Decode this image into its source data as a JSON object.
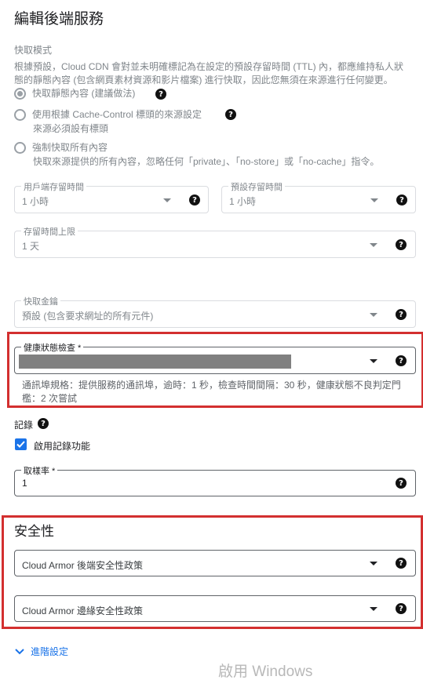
{
  "page": {
    "title": "編輯後端服務"
  },
  "cache_mode": {
    "label": "快取模式",
    "description": "根據預設，Cloud CDN 會對並未明確標記為在設定的預設存留時間 (TTL) 內，都應維持私人狀態的靜態內容 (包含網頁素材資源和影片檔案) 進行快取，因此您無須在來源進行任何變更。",
    "options": [
      {
        "label": "快取靜態內容 (建議做法)",
        "selected": true
      },
      {
        "label": "使用根據 Cache-Control 標頭的來源設定",
        "sub": "來源必須設有標頭",
        "selected": false
      },
      {
        "label": "強制快取所有內容",
        "sub": "快取來源提供的所有內容，忽略任何「private」、「no-store」或「no-cache」指令。",
        "selected": false
      }
    ]
  },
  "client_ttl": {
    "label": "用戶端存留時間",
    "value": "1 小時"
  },
  "default_ttl": {
    "label": "預設存留時間",
    "value": "1 小時"
  },
  "max_ttl": {
    "label": "存留時間上限",
    "value": "1 天"
  },
  "cache_key": {
    "label": "快取金鑰",
    "value": "預設 (包含要求網址的所有元件)"
  },
  "health_check": {
    "label": "健康狀態檢查 *",
    "value_redacted": true,
    "hint": "通訊埠規格：提供服務的通訊埠，逾時：1 秒，檢查時間間隔：30 秒，健康狀態不良判定門檻：2 次嘗試"
  },
  "logging": {
    "label": "記錄",
    "checkbox_label": "啟用記錄功能",
    "checked": true,
    "sample_rate_label": "取樣率 *",
    "sample_rate_value": "1"
  },
  "security": {
    "title": "安全性",
    "backend_policy_placeholder": "Cloud Armor 後端安全性政策",
    "edge_policy_placeholder": "Cloud Armor 邊緣安全性政策"
  },
  "advanced": {
    "label": "進階設定"
  },
  "watermark": "啟用 Windows",
  "colors": {
    "accent": "#1a73e8",
    "highlight": "#d32f2f",
    "redacted": "#808080"
  }
}
